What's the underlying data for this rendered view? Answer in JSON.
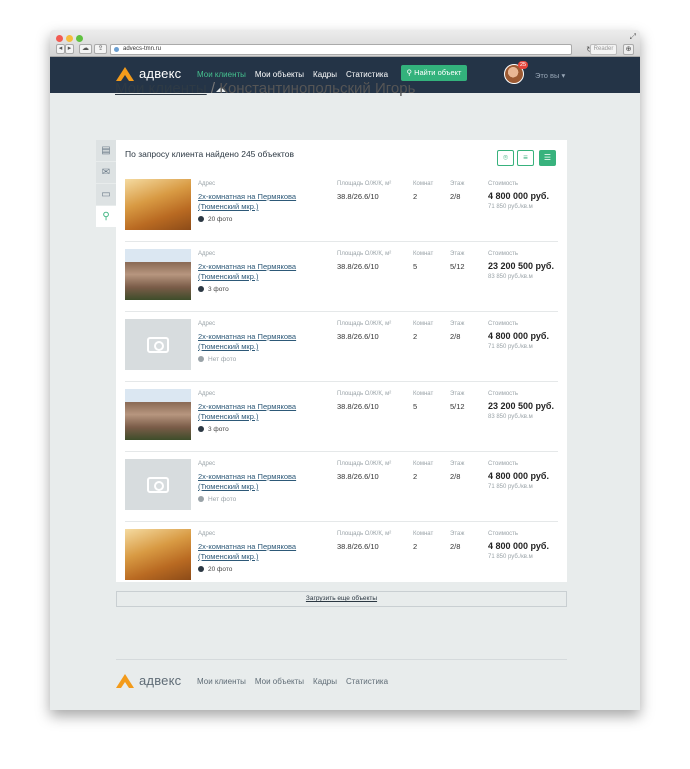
{
  "browser": {
    "url": "advecs-tmn.ru",
    "reader_label": "Reader"
  },
  "header": {
    "logo_text": "адвекс",
    "nav": [
      "Мои клиенты",
      "Мои объекты",
      "Кадры",
      "Статистика"
    ],
    "find_button": "Найти объект",
    "badge_count": "25",
    "user_label": "Это вы ▾"
  },
  "page": {
    "breadcrumb_link": "Мои клиенты",
    "separator": "/",
    "client_name": "Константинопольский Игорь",
    "found_text": "По запросу клиента найдено 245 объектов"
  },
  "column_labels": {
    "address": "Адрес",
    "area": "Площадь О/Ж/К, м²",
    "rooms": "Комнат",
    "floor": "Этаж",
    "cost": "Стоимость"
  },
  "listings": [
    {
      "photo": "room",
      "address": "2х-комнатная на Пермякова (Тюменский мкр.)",
      "photos": "20 фото",
      "area": "38.8/26.6/10",
      "rooms": "2",
      "floor": "2/8",
      "price": "4 800 000 руб.",
      "per_m": "71 850 руб./кв.м"
    },
    {
      "photo": "building",
      "address": "2х-комнатная на Пермякова (Тюменский мкр.)",
      "photos": "3 фото",
      "area": "38.8/26.6/10",
      "rooms": "5",
      "floor": "5/12",
      "price": "23 200 500 руб.",
      "per_m": "83 850 руб./кв.м"
    },
    {
      "photo": "none",
      "address": "2х-комнатная на Пермякова (Тюменский мкр.)",
      "photos": "Нет фото",
      "area": "38.8/26.6/10",
      "rooms": "2",
      "floor": "2/8",
      "price": "4 800 000 руб.",
      "per_m": "71 850 руб./кв.м"
    },
    {
      "photo": "building",
      "address": "2х-комнатная на Пермякова (Тюменский мкр.)",
      "photos": "3 фото",
      "area": "38.8/26.6/10",
      "rooms": "5",
      "floor": "5/12",
      "price": "23 200 500 руб.",
      "per_m": "83 850 руб./кв.м"
    },
    {
      "photo": "none",
      "address": "2х-комнатная на Пермякова (Тюменский мкр.)",
      "photos": "Нет фото",
      "area": "38.8/26.6/10",
      "rooms": "2",
      "floor": "2/8",
      "price": "4 800 000 руб.",
      "per_m": "71 850 руб./кв.м"
    },
    {
      "photo": "room",
      "address": "2х-комнатная на Пермякова (Тюменский мкр.)",
      "photos": "20 фото",
      "area": "38.8/26.6/10",
      "rooms": "2",
      "floor": "2/8",
      "price": "4 800 000 руб.",
      "per_m": "71 850 руб./кв.м"
    }
  ],
  "load_more": "Загрузить еще объекты",
  "footer": {
    "logo_text": "адвекс",
    "nav": [
      "Мои клиенты",
      "Мои объекты",
      "Кадры",
      "Статистика"
    ]
  },
  "colors": {
    "navbar": "#243447",
    "accent": "#38b27d",
    "logo": "#f39b1b"
  }
}
